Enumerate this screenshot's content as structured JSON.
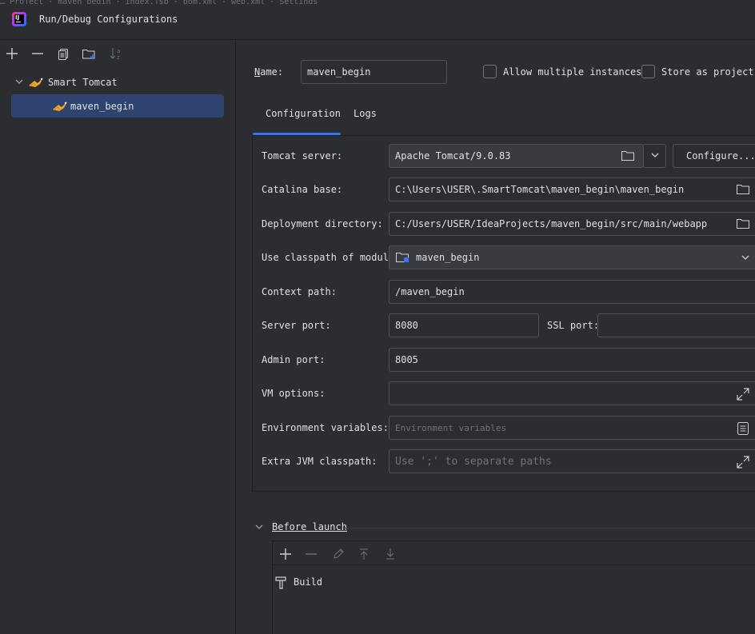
{
  "window": {
    "title": "Run/Debug Configurations",
    "background_strip": "…      Project      ·      maven_begin      ·      index.jsp      ·      pom.xml      ·      web.xml      ·      Settings"
  },
  "toolbar": {
    "icons": [
      "add-icon",
      "remove-icon",
      "copy-icon",
      "new-folder-icon",
      "sort-icon"
    ]
  },
  "tree": {
    "group_label": "Smart Tomcat",
    "item_label": "maven_begin"
  },
  "name_row": {
    "label": "Name:",
    "value": "maven_begin",
    "allow_multiple": "Allow multiple instances",
    "store_as_project": "Store as project fil"
  },
  "tabs": [
    "Configuration",
    "Logs"
  ],
  "form": {
    "tomcat_server": {
      "label": "Tomcat server:",
      "value": "Apache Tomcat/9.0.83",
      "configure": "Configure..."
    },
    "catalina_base": {
      "label": "Catalina base:",
      "value": "C:\\Users\\USER\\.SmartTomcat\\maven_begin\\maven_begin"
    },
    "deployment_dir": {
      "label": "Deployment directory:",
      "value": "C:/Users/USER/IdeaProjects/maven_begin/src/main/webapp"
    },
    "classpath_module": {
      "label": "Use classpath of module:",
      "value": "maven_begin"
    },
    "context_path": {
      "label": "Context path:",
      "value": "/maven_begin"
    },
    "server_port": {
      "label": "Server port:",
      "value": "8080"
    },
    "ssl_port": {
      "label": "SSL port:",
      "value": ""
    },
    "admin_port": {
      "label": "Admin port:",
      "value": "8005"
    },
    "vm_options": {
      "label": "VM options:",
      "value": ""
    },
    "env_vars": {
      "label": "Environment variables:",
      "placeholder": "Environment variables"
    },
    "extra_classpath": {
      "label": "Extra JVM classpath:",
      "placeholder": "Use ';' to separate paths"
    }
  },
  "before_launch": {
    "label": "Before launch",
    "task": "Build"
  },
  "colors": {
    "background": "#2b2d30",
    "selection": "#2e436e",
    "accent": "#3574f0",
    "field_border": "#4e5157"
  }
}
